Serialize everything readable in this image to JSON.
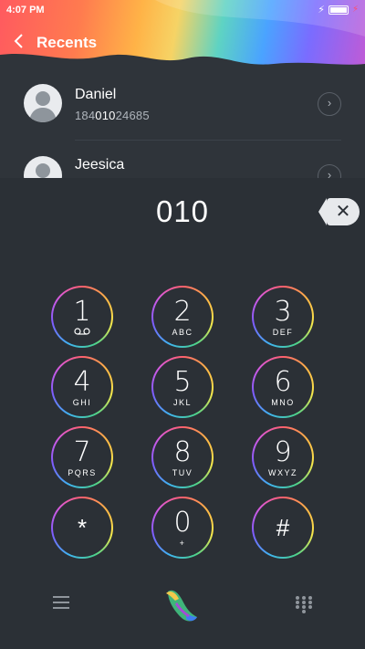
{
  "status_bar": {
    "time": "4:07 PM"
  },
  "header": {
    "title": "Recents"
  },
  "contacts": [
    {
      "name": "Daniel",
      "number_prefix": "184",
      "number_match": "010",
      "number_suffix": "24685"
    },
    {
      "name": "Jeesica"
    }
  ],
  "dialer": {
    "input": "010"
  },
  "keypad": [
    {
      "digit": "1",
      "letters": "",
      "icon": "voicemail-icon"
    },
    {
      "digit": "2",
      "letters": "ABC"
    },
    {
      "digit": "3",
      "letters": "DEF"
    },
    {
      "digit": "4",
      "letters": "GHI"
    },
    {
      "digit": "5",
      "letters": "JKL"
    },
    {
      "digit": "6",
      "letters": "MNO"
    },
    {
      "digit": "7",
      "letters": "PQRS"
    },
    {
      "digit": "8",
      "letters": "TUV"
    },
    {
      "digit": "9",
      "letters": "WXYZ"
    },
    {
      "digit": "*",
      "letters": ""
    },
    {
      "digit": "0",
      "letters": "+"
    },
    {
      "digit": "#",
      "letters": ""
    }
  ],
  "icons": {
    "back": "chevron-left-icon",
    "backspace": "close-icon",
    "menu": "menu-icon",
    "call": "phone-icon",
    "keypad": "keypad-grid-icon"
  },
  "colors": {
    "background": "#2b3036",
    "text": "#ffffff",
    "secondary_text": "#aeb4bb"
  }
}
